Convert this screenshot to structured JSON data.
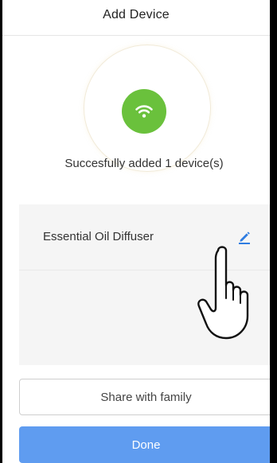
{
  "header": {
    "title": "Add Device"
  },
  "status": {
    "message": "Succesfully added 1 device(s)"
  },
  "devices": [
    {
      "name": "Essential Oil Diffuser",
      "action_icon": "pencil-edit-icon"
    }
  ],
  "buttons": {
    "share_label": "Share with family",
    "done_label": "Done"
  },
  "icons": {
    "status_icon": "wifi-icon",
    "overlay_icon": "pointing-hand-icon"
  },
  "colors": {
    "success_green": "#6ac13c",
    "primary_blue": "#5f9cf0",
    "edit_blue": "#2f7de1"
  }
}
